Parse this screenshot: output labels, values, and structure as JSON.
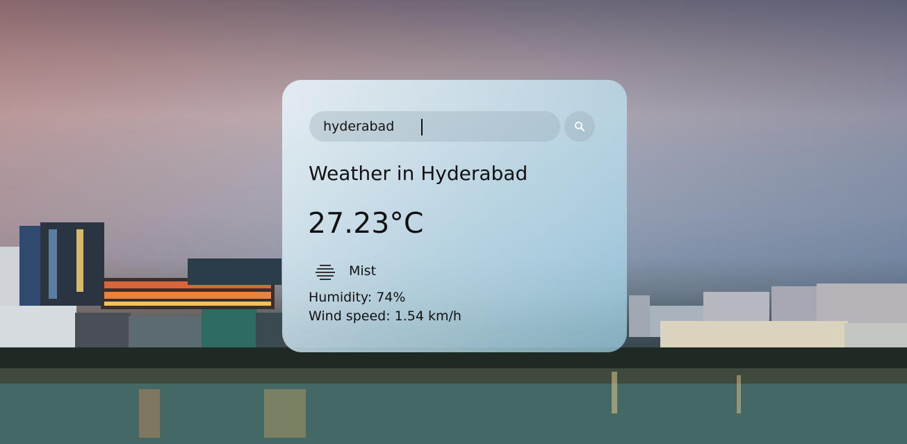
{
  "search": {
    "value": "hyderabad",
    "button_icon": "search-icon"
  },
  "weather": {
    "title": "Weather in Hyderabad",
    "temperature": "27.23°C",
    "condition_icon": "mist-icon",
    "condition": "Mist",
    "humidity": "Humidity: 74%",
    "wind": "Wind speed: 1.54 km/h"
  },
  "colors": {
    "text": "#111111",
    "card_tint": "#bfe0ee"
  }
}
